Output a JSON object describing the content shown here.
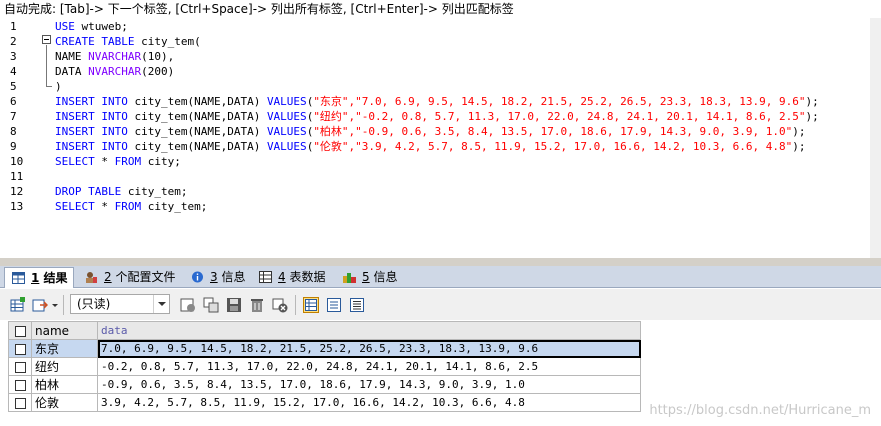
{
  "hint": "自动完成: [Tab]-> 下一个标签, [Ctrl+Space]-> 列出所有标签, [Ctrl+Enter]-> 列出匹配标签",
  "editor": {
    "line_numbers": [
      "1",
      "2",
      "3",
      "4",
      "5",
      "6",
      "7",
      "8",
      "9",
      "10",
      "11",
      "12",
      "13"
    ],
    "lines": [
      [
        {
          "c": "kw",
          "t": "USE "
        },
        {
          "c": "tx",
          "t": "wtuweb;"
        }
      ],
      [
        {
          "c": "kw",
          "t": "CREATE TABLE "
        },
        {
          "c": "tx",
          "t": "city_tem("
        }
      ],
      [
        {
          "c": "tx",
          "t": "NAME "
        },
        {
          "c": "ty",
          "t": "NVARCHAR"
        },
        {
          "c": "tx",
          "t": "(10),"
        }
      ],
      [
        {
          "c": "tx",
          "t": "DATA "
        },
        {
          "c": "ty",
          "t": "NVARCHAR"
        },
        {
          "c": "tx",
          "t": "(200)"
        }
      ],
      [
        {
          "c": "tx",
          "t": ")"
        }
      ],
      [
        {
          "c": "kw",
          "t": "INSERT INTO "
        },
        {
          "c": "tx",
          "t": "city_tem(NAME,DATA) "
        },
        {
          "c": "kw",
          "t": "VALUES"
        },
        {
          "c": "tx",
          "t": "("
        },
        {
          "c": "st",
          "t": "\"东京\",\"7.0, 6.9, 9.5, 14.5, 18.2, 21.5, 25.2, 26.5, 23.3, 18.3, 13.9, 9.6\""
        },
        {
          "c": "tx",
          "t": ");"
        }
      ],
      [
        {
          "c": "kw",
          "t": "INSERT INTO "
        },
        {
          "c": "tx",
          "t": "city_tem(NAME,DATA) "
        },
        {
          "c": "kw",
          "t": "VALUES"
        },
        {
          "c": "tx",
          "t": "("
        },
        {
          "c": "st",
          "t": "\"纽约\",\"-0.2, 0.8, 5.7, 11.3, 17.0, 22.0, 24.8, 24.1, 20.1, 14.1, 8.6, 2.5\""
        },
        {
          "c": "tx",
          "t": ");"
        }
      ],
      [
        {
          "c": "kw",
          "t": "INSERT INTO "
        },
        {
          "c": "tx",
          "t": "city_tem(NAME,DATA) "
        },
        {
          "c": "kw",
          "t": "VALUES"
        },
        {
          "c": "tx",
          "t": "("
        },
        {
          "c": "st",
          "t": "\"柏林\",\"-0.9, 0.6, 3.5, 8.4, 13.5, 17.0, 18.6, 17.9, 14.3, 9.0, 3.9, 1.0\""
        },
        {
          "c": "tx",
          "t": ");"
        }
      ],
      [
        {
          "c": "kw",
          "t": "INSERT INTO "
        },
        {
          "c": "tx",
          "t": "city_tem(NAME,DATA) "
        },
        {
          "c": "kw",
          "t": "VALUES"
        },
        {
          "c": "tx",
          "t": "("
        },
        {
          "c": "st",
          "t": "\"伦敦\",\"3.9, 4.2, 5.7, 8.5, 11.9, 15.2, 17.0, 16.6, 14.2, 10.3, 6.6, 4.8\""
        },
        {
          "c": "tx",
          "t": ");"
        }
      ],
      [
        {
          "c": "kw",
          "t": "SELECT "
        },
        {
          "c": "tx",
          "t": "* "
        },
        {
          "c": "kw",
          "t": "FROM "
        },
        {
          "c": "tx",
          "t": "city;"
        }
      ],
      [],
      [
        {
          "c": "kw",
          "t": "DROP TABLE "
        },
        {
          "c": "tx",
          "t": "city_tem;"
        }
      ],
      [
        {
          "c": "kw",
          "t": "SELECT "
        },
        {
          "c": "tx",
          "t": "* "
        },
        {
          "c": "kw",
          "t": "FROM "
        },
        {
          "c": "tx",
          "t": "city_tem;"
        }
      ]
    ]
  },
  "tabs": [
    {
      "num": "1",
      "label": " 结果",
      "active": true,
      "icon": "result-grid-icon"
    },
    {
      "num": "2",
      "label": " 个配置文件",
      "active": false,
      "icon": "profile-icon"
    },
    {
      "num": "3",
      "label": " 信息",
      "active": false,
      "icon": "info-icon"
    },
    {
      "num": "4",
      "label": " 表数据",
      "active": false,
      "icon": "table-data-icon"
    },
    {
      "num": "5",
      "label": " 信息",
      "active": false,
      "icon": "info-history-icon"
    }
  ],
  "toolbar": {
    "mode_select": "(只读)"
  },
  "grid": {
    "columns": [
      "name",
      "data"
    ],
    "rows": [
      {
        "name": "东京",
        "data": "7.0, 6.9, 9.5, 14.5, 18.2, 21.5, 25.2, 26.5, 23.3, 18.3, 13.9, 9.6"
      },
      {
        "name": "纽约",
        "data": "-0.2, 0.8, 5.7, 11.3, 17.0, 22.0, 24.8, 24.1, 20.1, 14.1, 8.6, 2.5"
      },
      {
        "name": "柏林",
        "data": "-0.9, 0.6, 3.5, 8.4, 13.5, 17.0, 18.6, 17.9, 14.3, 9.0, 3.9, 1.0"
      },
      {
        "name": "伦敦",
        "data": "3.9, 4.2, 5.7, 8.5, 11.9, 15.2, 17.0, 16.6, 14.2, 10.3, 6.6, 4.8"
      }
    ]
  },
  "watermark": "https://blog.csdn.net/Hurricane_m",
  "colors": {
    "keyword": "#0000ff",
    "string": "#ff0000",
    "type": "#7f00ff",
    "tab_bar": "#cfd8e6"
  }
}
